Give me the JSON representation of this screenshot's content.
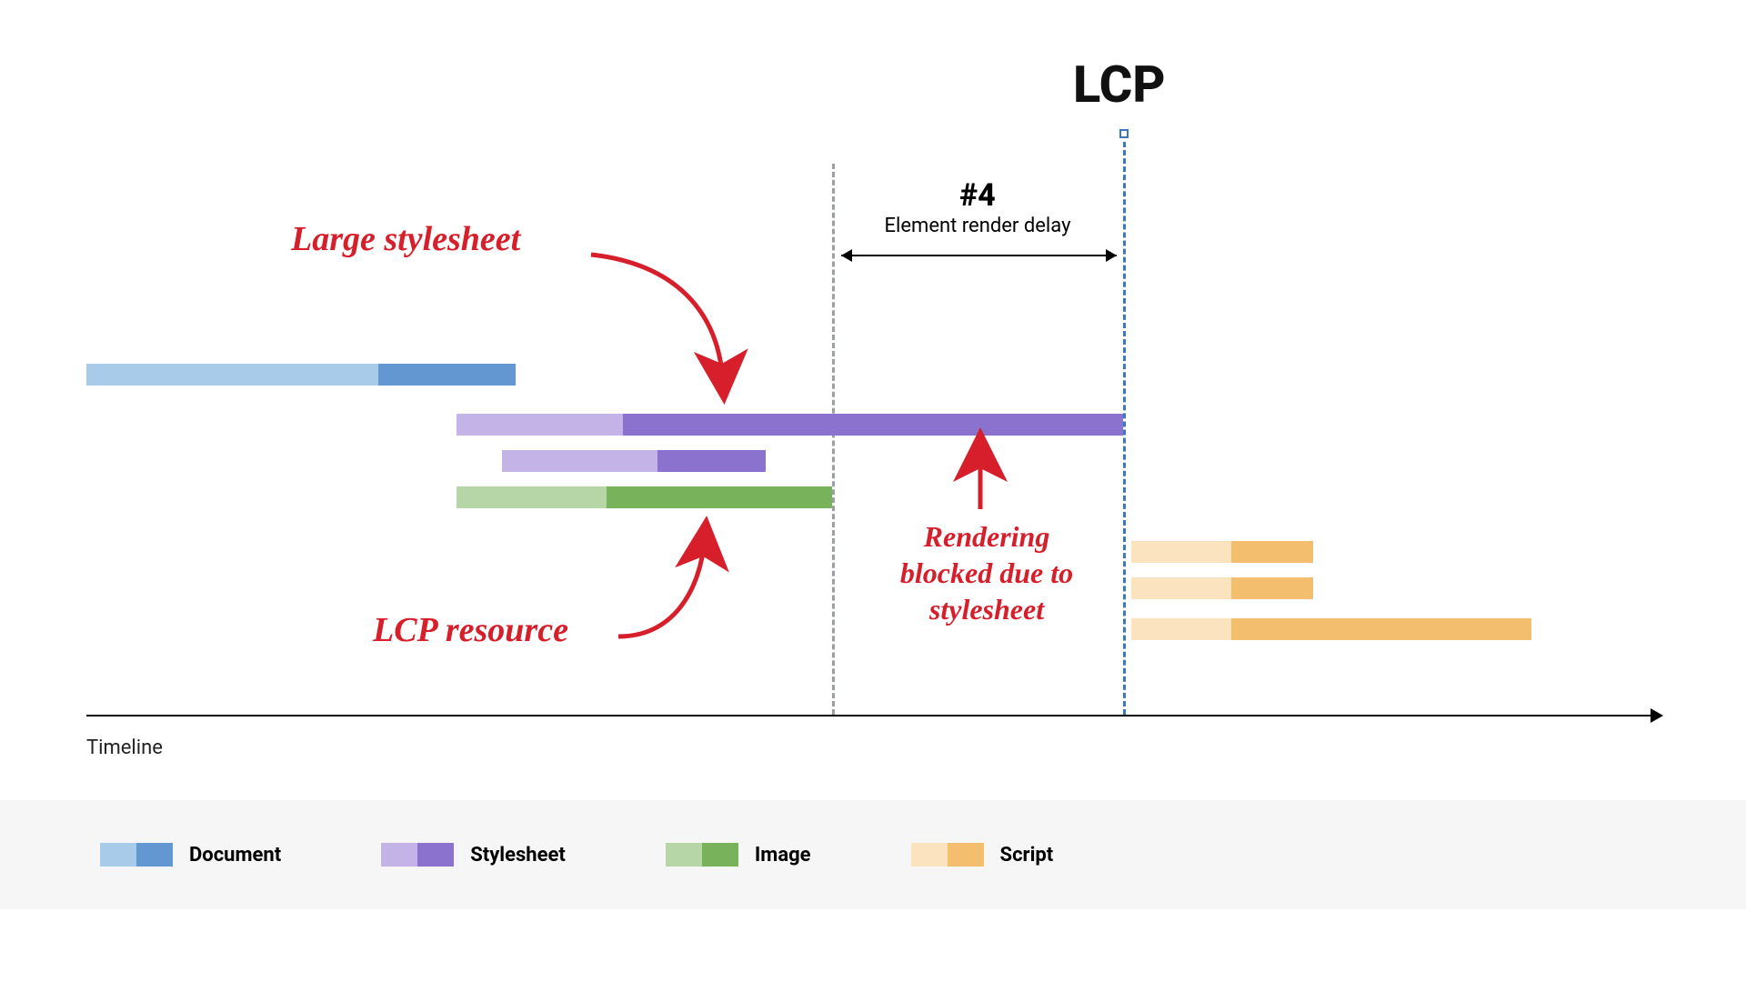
{
  "title": "LCP",
  "segment": {
    "num": "#4",
    "label": "Element render delay"
  },
  "annotations": {
    "large_stylesheet": "Large stylesheet",
    "lcp_resource": "LCP resource",
    "blocked": "Rendering\nblocked due to\nstylesheet"
  },
  "axis_label": "Timeline",
  "legend": {
    "document": "Document",
    "stylesheet": "Stylesheet",
    "image": "Image",
    "script": "Script"
  },
  "colors": {
    "doc_light": "#a9cbea",
    "doc_dark": "#6297d1",
    "sty_light": "#c3b3e6",
    "sty_dark": "#8b72cf",
    "img_light": "#b6d6a8",
    "img_dark": "#78b25b",
    "scr_light": "#fce3c0",
    "scr_dark": "#f3bf6e",
    "red": "#d61f2a",
    "gray_dash": "#9aa0a6",
    "blue_dash": "#3b78c3"
  },
  "chart_data": {
    "type": "gantt",
    "timeline_range": [
      0,
      100
    ],
    "lcp_at": 69.5,
    "render_delay_start": 54,
    "bars": [
      {
        "name": "document",
        "row": 0,
        "start": 5,
        "mid": 24,
        "end": 33,
        "kind": "document"
      },
      {
        "name": "stylesheet-large",
        "row": 1,
        "start": 29,
        "mid": 39,
        "end": 69.5,
        "kind": "stylesheet"
      },
      {
        "name": "stylesheet-2",
        "row": 2,
        "start": 32,
        "mid": 42,
        "end": 49,
        "kind": "stylesheet"
      },
      {
        "name": "image-lcp",
        "row": 3,
        "start": 29,
        "mid": 39,
        "end": 54,
        "kind": "image"
      },
      {
        "name": "script-1",
        "row": 4,
        "start": 70,
        "mid": 78,
        "end": 83,
        "kind": "script"
      },
      {
        "name": "script-2",
        "row": 5,
        "start": 70,
        "mid": 78,
        "end": 83,
        "kind": "script"
      },
      {
        "name": "script-3",
        "row": 6,
        "start": 70,
        "mid": 78,
        "end": 97,
        "kind": "script"
      }
    ]
  }
}
